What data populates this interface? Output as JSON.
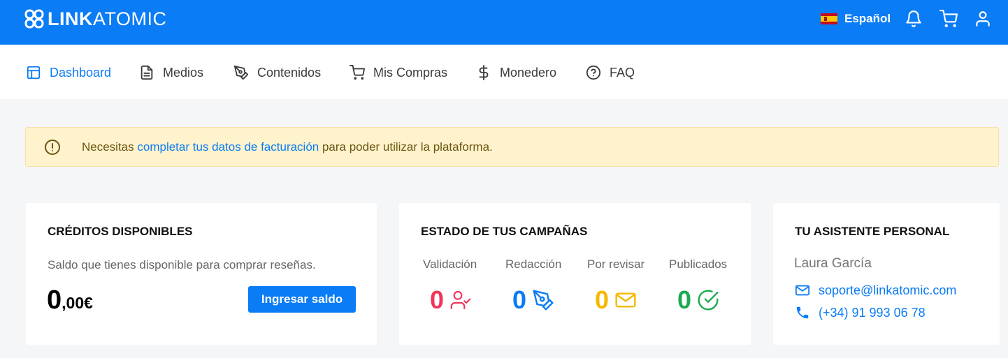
{
  "header": {
    "logo_bold": "LINK",
    "logo_light": "ATOMIC",
    "language": "Español"
  },
  "nav": {
    "items": [
      {
        "label": "Dashboard",
        "icon": "layout-icon"
      },
      {
        "label": "Medios",
        "icon": "document-icon"
      },
      {
        "label": "Contenidos",
        "icon": "pen-tool-icon"
      },
      {
        "label": "Mis Compras",
        "icon": "cart-icon"
      },
      {
        "label": "Monedero",
        "icon": "dollar-icon"
      },
      {
        "label": "FAQ",
        "icon": "help-circle-icon"
      }
    ]
  },
  "alert": {
    "text_before": "Necesitas ",
    "link": "completar tus datos de facturación",
    "text_after": " para poder utilizar la plataforma."
  },
  "credits": {
    "title": "CRÉDITOS DISPONIBLES",
    "description": "Saldo que tienes disponible para comprar reseñas.",
    "amount_int": "0",
    "amount_dec": ",00€",
    "button": "Ingresar saldo"
  },
  "campaigns": {
    "title": "ESTADO DE TUS CAMPAÑAS",
    "stats": [
      {
        "label": "Validación",
        "value": "0",
        "color": "#f0365c",
        "icon": "user-check-icon"
      },
      {
        "label": "Redacción",
        "value": "0",
        "color": "#0a7cf5",
        "icon": "pen-tool-icon"
      },
      {
        "label": "Por revisar",
        "value": "0",
        "color": "#f5b800",
        "icon": "mail-icon"
      },
      {
        "label": "Publicados",
        "value": "0",
        "color": "#1eaa52",
        "icon": "check-circle-icon"
      }
    ]
  },
  "assistant": {
    "title": "TU ASISTENTE PERSONAL",
    "name": "Laura García",
    "email": "soporte@linkatomic.com",
    "phone": "(+34) 91 993 06 78"
  },
  "colors": {
    "primary": "#0a7cf5",
    "alert_bg": "#fff3cd",
    "alert_text": "#6d5410"
  }
}
